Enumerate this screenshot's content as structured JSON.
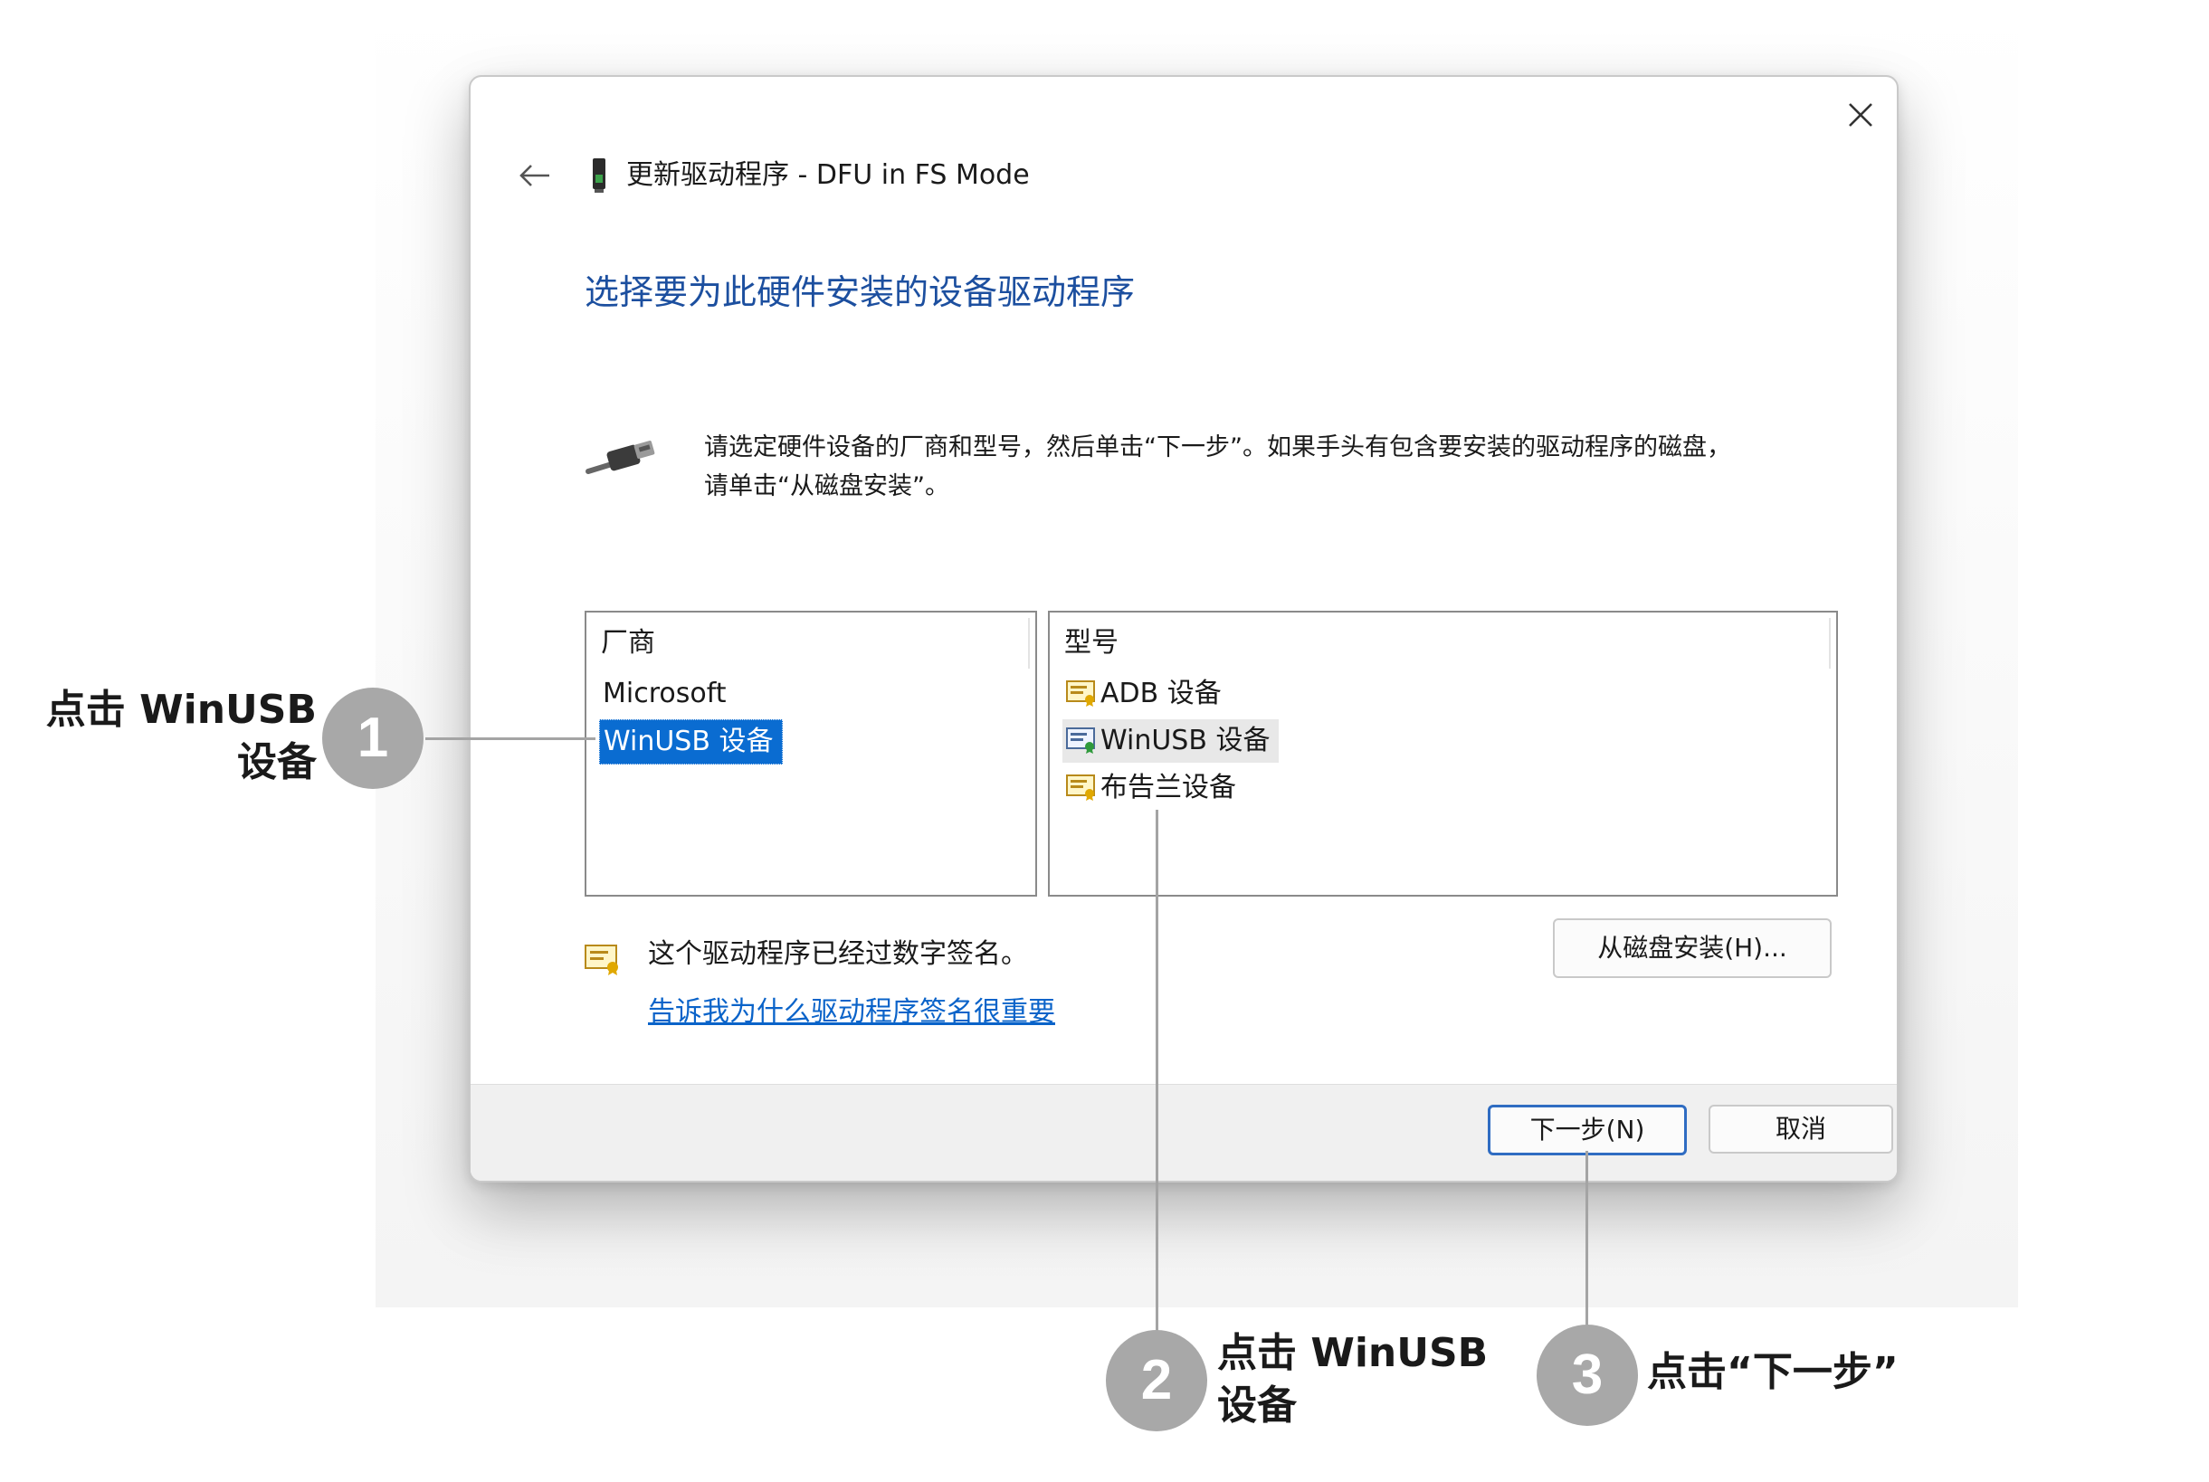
{
  "dialog": {
    "window_title": "更新驱动程序 - DFU in FS Mode",
    "heading": "选择要为此硬件安装的设备驱动程序",
    "instructions_line1": "请选定硬件设备的厂商和型号，然后单击“下一步”。如果手头有包含要安装的驱动程序的磁盘，",
    "instructions_line2": "请单击“从磁盘安装”。",
    "vendor_list": {
      "header": "厂商",
      "items": [
        "Microsoft",
        "WinUSB 设备"
      ],
      "selected_index": 1
    },
    "model_list": {
      "header": "型号",
      "items": [
        "ADB 设备",
        "WinUSB 设备",
        "布告兰设备"
      ],
      "highlighted_index": 1
    },
    "signed_text": "这个驱动程序已经过数字签名。",
    "signed_link": "告诉我为什么驱动程序签名很重要",
    "buttons": {
      "have_disk": "从磁盘安装(H)...",
      "next": "下一步(N)",
      "cancel": "取消"
    }
  },
  "callouts": [
    {
      "number": "1",
      "line1": "点击 WinUSB",
      "line2": "设备"
    },
    {
      "number": "2",
      "line1": "点击 WinUSB",
      "line2": "设备"
    },
    {
      "number": "3",
      "line1": "点击“下一步”"
    }
  ],
  "colors": {
    "heading": "#1c4f9f",
    "selection": "#0a6cd1",
    "link": "#0a63c9",
    "primary_button_border": "#2f6cc2",
    "badge": "#a8a8a8"
  }
}
